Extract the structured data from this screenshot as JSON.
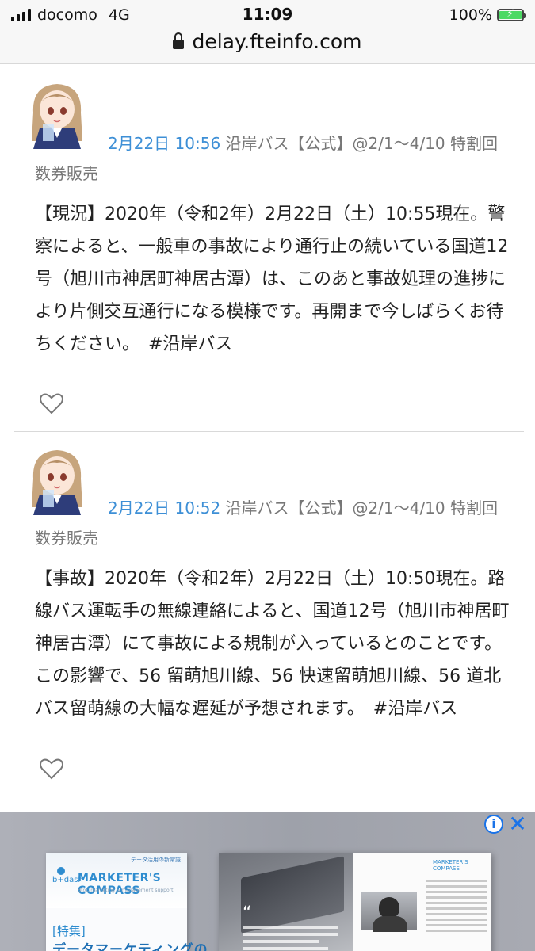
{
  "status_bar": {
    "carrier": "docomo",
    "network": "4G",
    "time": "11:09",
    "battery": "100%",
    "battery_level": 1.0,
    "battery_color": "#4cd964"
  },
  "browser": {
    "url": "delay.fteinfo.com",
    "lock_icon": "lock-icon"
  },
  "posts": [
    {
      "date": "2月22日 10:56",
      "account": "沿岸バス【公式】@2/1〜4/10 特割回数券販売",
      "body": "【現況】2020年（令和2年）2月22日（土）10:55現在。警察によると、一般車の事故により通行止の続いている国道12号（旭川市神居町神居古潭）は、このあと事故処理の進捗により片側交互通行になる模様です。再開まで今しばらくお待ちください。　#沿岸バス",
      "like_icon": "heart-icon"
    },
    {
      "date": "2月22日 10:52",
      "account": "沿岸バス【公式】@2/1〜4/10 特割回数券販売",
      "body": "【事故】2020年（令和2年）2月22日（土）10:50現在。路線バス運転手の無線連絡によると、国道12号（旭川市神居町神居古潭）にて事故による規制が入っているとのことです。この影響で、56 留萌旭川線、56 快速留萌旭川線、56 道北バス留萌線の大幅な遅延が予想されます。　#沿岸バス",
      "like_icon": "heart-icon"
    }
  ],
  "ad": {
    "info_glyph": "i",
    "close_glyph": "✕",
    "magazine_tag": "データ活用の新常識",
    "brand": "b+dash",
    "magazine_title": "MARKETER'S COMPASS",
    "magazine_subtitle": "BtoC marketing & management support",
    "feature_label": "[特集]",
    "headline": "データマーケティングの",
    "quote_mark": "“",
    "right_logo": "MARKETER'S COMPASS"
  },
  "colors": {
    "link_blue": "#3d8fd6",
    "ad_blue": "#1a73e8",
    "divider": "#d9d9d9"
  }
}
